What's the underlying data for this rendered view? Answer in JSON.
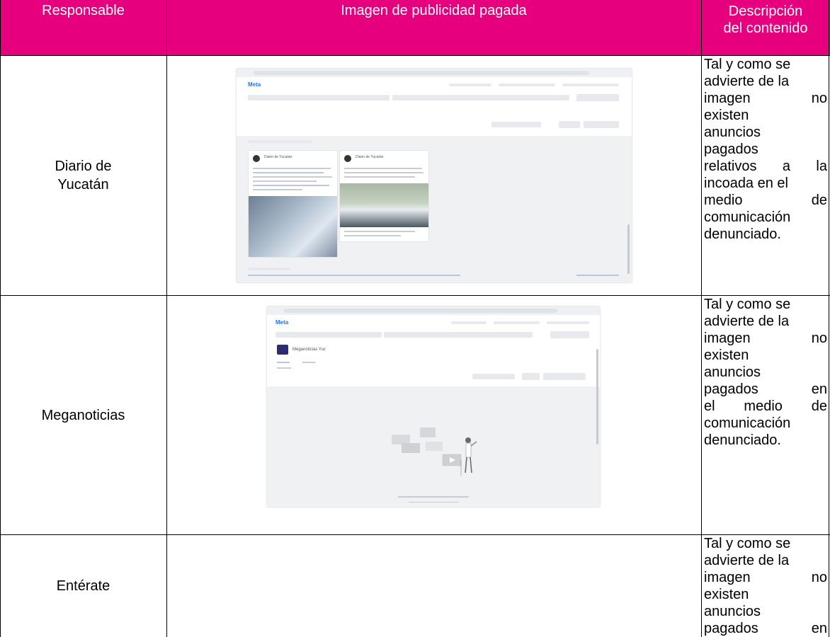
{
  "table": {
    "headers": {
      "responsable": "Responsable",
      "imagen": "Imagen de publicidad pagada",
      "descripcion_line1": "Descripción",
      "descripcion_line2": "del contenido"
    },
    "rows": [
      {
        "responsable_line1": "Diario de",
        "responsable_line2": "Yucatán",
        "description_lines": [
          "Tal y como se",
          "advierte de la",
          "imagen no",
          "existen",
          "anuncios",
          "pagados",
          "relativos a la",
          "incoada en el",
          "medio de",
          "comunicación",
          "denunciado."
        ]
      },
      {
        "responsable_line1": "Meganoticias",
        "responsable_line2": "",
        "description_lines": [
          "Tal y como se",
          "advierte de la",
          "imagen no",
          "existen",
          "anuncios",
          "pagados en",
          "el medio de",
          "comunicación",
          "denunciado."
        ]
      },
      {
        "responsable_line1": "Entérate",
        "responsable_line2": "",
        "description_lines": [
          "Tal y como se",
          "advierte de la",
          "imagen no",
          "existen",
          "anuncios",
          "pagados en"
        ]
      }
    ]
  },
  "screenshots": {
    "first": {
      "brand": "Meta",
      "page_name": "Diario de Yucatán"
    },
    "second": {
      "brand": "Meta",
      "page_name": "Meganoticias Yuc"
    }
  },
  "colors": {
    "header_bg": "#e6007e",
    "header_text": "#ffffff",
    "border": "#000000"
  }
}
